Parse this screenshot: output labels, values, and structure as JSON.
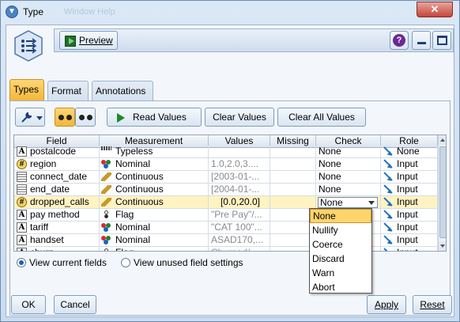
{
  "window": {
    "title": "Type",
    "ghost_text": "Window  Help"
  },
  "header": {
    "preview_label": "Preview"
  },
  "tabs": [
    "Types",
    "Format",
    "Annotations"
  ],
  "toolbar": {
    "read_values": "Read Values",
    "clear_values": "Clear Values",
    "clear_all_values": "Clear All Values"
  },
  "columns": [
    "Field",
    "Measurement",
    "Values",
    "Missing",
    "Check",
    "Role"
  ],
  "rows": [
    {
      "field": "postalcode",
      "field_icon": "A",
      "measurement": "Typeless",
      "m_icon": "typeless",
      "values": "",
      "missing": "",
      "check": "None",
      "role": "None"
    },
    {
      "field": "region",
      "field_icon": "pin",
      "measurement": "Nominal",
      "m_icon": "nominal",
      "values": "1.0,2.0,3....",
      "missing": "",
      "check": "None",
      "role": "Input"
    },
    {
      "field": "connect_date",
      "field_icon": "cal",
      "measurement": "Continuous",
      "m_icon": "ruler",
      "values": "[2003-01-...",
      "missing": "",
      "check": "None",
      "role": "Input"
    },
    {
      "field": "end_date",
      "field_icon": "cal",
      "measurement": "Continuous",
      "m_icon": "ruler",
      "values": "[2004-01-...",
      "missing": "",
      "check": "None",
      "role": "Input"
    },
    {
      "field": "dropped_calls",
      "field_icon": "pin",
      "measurement": "Continuous",
      "m_icon": "ruler",
      "values": "[0.0,20.0]",
      "missing": "",
      "check": "None",
      "role": "Input",
      "selected": true
    },
    {
      "field": "pay method",
      "field_icon": "A",
      "measurement": "Flag",
      "m_icon": "flag",
      "values": "\"Pre Pay\"/...",
      "missing": "",
      "check": "",
      "role": "Input"
    },
    {
      "field": "tariff",
      "field_icon": "A",
      "measurement": "Nominal",
      "m_icon": "nominal",
      "values": "\"CAT 100\"...",
      "missing": "",
      "check": "",
      "role": "Input"
    },
    {
      "field": "handset",
      "field_icon": "A",
      "measurement": "Nominal",
      "m_icon": "nominal",
      "values": "ASAD170,...",
      "missing": "",
      "check": "",
      "role": "Input"
    },
    {
      "field": "churn",
      "field_icon": "A",
      "measurement": "Flag",
      "m_icon": "flag",
      "values": "Churned/...",
      "missing": "",
      "check": "",
      "role": "Input"
    }
  ],
  "check_options": [
    "None",
    "Nullify",
    "Coerce",
    "Discard",
    "Warn",
    "Abort"
  ],
  "radios": {
    "current": "View current fields",
    "unused": "View unused field settings"
  },
  "buttons": {
    "ok": "OK",
    "cancel": "Cancel",
    "apply": "Apply",
    "reset": "Reset"
  },
  "colors": {
    "accent": "#f3b537",
    "selected_row": "#fff3c2",
    "role_arrow": "#1f6fbf"
  }
}
